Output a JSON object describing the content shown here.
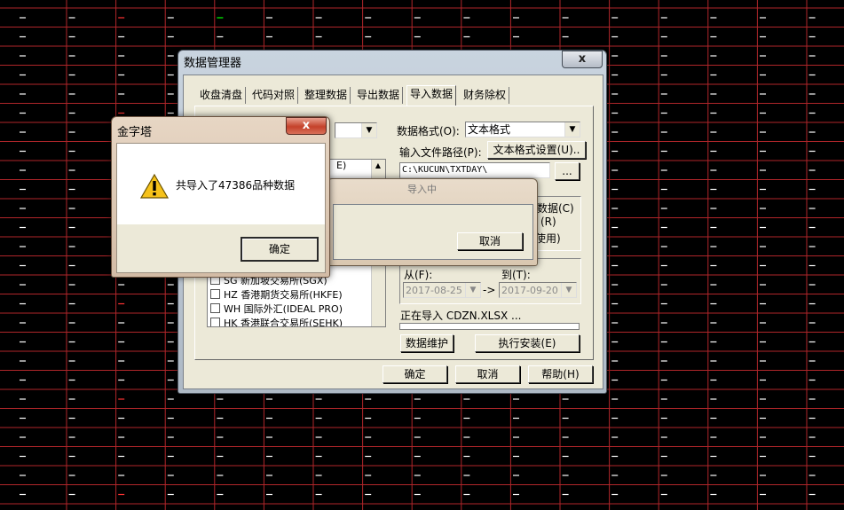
{
  "background": {
    "grid_line_color": "#b0262a",
    "dash_color": "#ffffff",
    "accent_dash_color": "#00ff00",
    "marker_color": "#ff3333"
  },
  "manager": {
    "title": "数据管理器",
    "tabs": [
      "收盘清盘",
      "代码对照",
      "整理数据",
      "导出数据",
      "导入数据",
      "财务除权"
    ],
    "active_tab": "导入数据",
    "data_format_label": "数据格式(O):",
    "data_format_value": "文本格式",
    "input_path_label": "输入文件路径(P):",
    "text_settings_button": "文本格式设置(U)..",
    "path_value": "C:\\KUCUN\\TXTDAY\\",
    "browse_button": "...",
    "options": {
      "line1_suffix": "数据(C)",
      "line2_suffix": "(R)",
      "line3_suffix": "使用)"
    },
    "from_label": "从(F):",
    "to_label": "到(T):",
    "from_date": "2017-08-25",
    "to_date": "2017-09-20",
    "arrow_text": "->",
    "status_text": "正在导入 CDZN.XLSX ...",
    "maintain_button": "数据维护",
    "install_button": "执行安装(E)",
    "ok_button": "确定",
    "cancel_button": "取消",
    "help_button": "帮助(H)",
    "market_list": [
      {
        "code": "SG",
        "name": "新加坡交易所(SGX)"
      },
      {
        "code": "HZ",
        "name": "香港期货交易所(HKFE)"
      },
      {
        "code": "WH",
        "name": "国际外汇(IDEAL PRO)"
      },
      {
        "code": "HK",
        "name": "香港联合交易所(SEHK)"
      }
    ],
    "list_partial_top": "E)"
  },
  "progress_dialog": {
    "title": "导入中",
    "cancel_button": "取消"
  },
  "message_box": {
    "title": "金字塔",
    "close_label": "x",
    "message": "共导入了47386品种数据",
    "ok_button": "确定",
    "icon": "warning-icon"
  },
  "manager_close_label": "x"
}
